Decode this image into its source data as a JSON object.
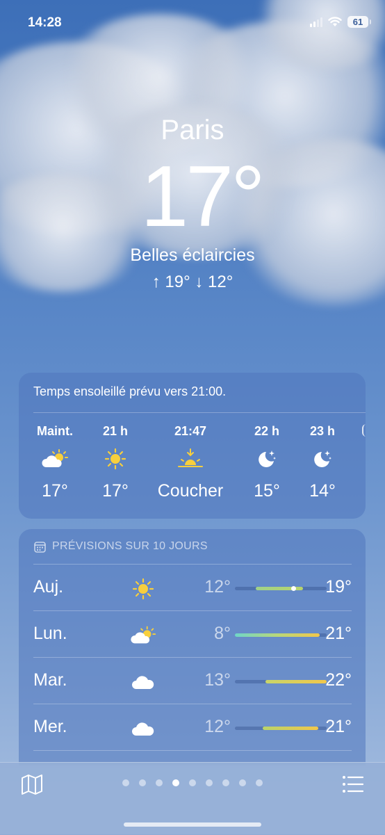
{
  "status_bar": {
    "time": "14:28",
    "battery": "61"
  },
  "location": {
    "city": "Paris",
    "temperature": "17°",
    "condition": "Belles éclaircies",
    "high_low": "↑ 19° ↓ 12°"
  },
  "hourly": {
    "summary": "Temps ensoleillé prévu vers 21:00.",
    "items": [
      {
        "label": "Maint.",
        "icon": "partly-sunny-icon",
        "temp": "17°"
      },
      {
        "label": "21 h",
        "icon": "sun-icon",
        "temp": "17°"
      },
      {
        "label": "21:47",
        "icon": "sunset-icon",
        "temp": "Coucher"
      },
      {
        "label": "22 h",
        "icon": "moon-stars-icon",
        "temp": "15°"
      },
      {
        "label": "23 h",
        "icon": "moon-stars-icon",
        "temp": "14°"
      }
    ]
  },
  "daily": {
    "header": "PRÉVISIONS SUR 10 JOURS",
    "rows": [
      {
        "day": "Auj.",
        "icon": "sun-icon",
        "low": "12°",
        "high": "19°"
      },
      {
        "day": "Lun.",
        "icon": "partly-sunny-icon",
        "low": "8°",
        "high": "21°"
      },
      {
        "day": "Mar.",
        "icon": "cloud-icon",
        "low": "13°",
        "high": "22°"
      },
      {
        "day": "Mer.",
        "icon": "cloud-icon",
        "low": "12°",
        "high": "21°"
      }
    ]
  },
  "colors": {
    "sun": "#f7cf3d",
    "bar_green": "#9fd18a",
    "bar_teal": "#6fd6c8",
    "bar_yellow": "#f2c74a"
  },
  "pager": {
    "count": 9,
    "active_index": 3
  }
}
